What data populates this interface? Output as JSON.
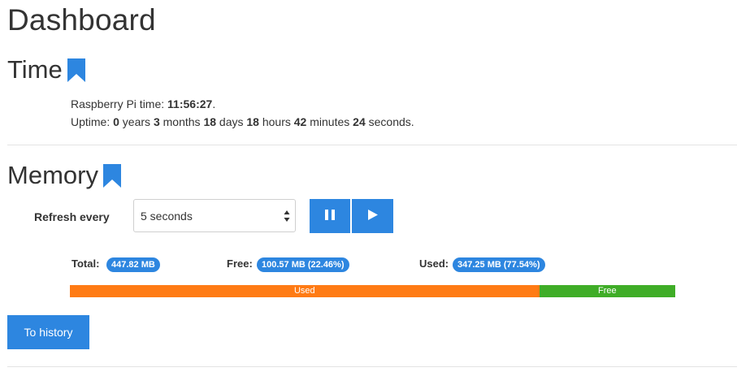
{
  "page": {
    "title": "Dashboard"
  },
  "time": {
    "title": "Time",
    "pi_time_label": "Raspberry Pi time: ",
    "pi_time_value": "11:56:27",
    "pi_time_suffix": ".",
    "uptime_label": "Uptime: ",
    "years": "0",
    "years_label": " years ",
    "months": "3",
    "months_label": " months ",
    "days": "18",
    "days_label": " days ",
    "hours": "18",
    "hours_label": " hours ",
    "minutes": "42",
    "minutes_label": " minutes ",
    "seconds": "24",
    "seconds_label": " seconds."
  },
  "memory": {
    "title": "Memory",
    "refresh_label": "Refresh every",
    "refresh_selected": "5 seconds",
    "total_label": "Total:",
    "total_value": "447.82 MB",
    "free_label": "Free:",
    "free_value": "100.57 MB (22.46%)",
    "used_label": "Used:",
    "used_value": "347.25 MB (77.54%)",
    "bar": {
      "used_label": "Used",
      "free_label": "Free",
      "used_percent": 77.54,
      "free_percent": 22.46,
      "used_color": "#ff7b14",
      "free_color": "#3fad27"
    },
    "icons": {
      "pause": "pause-icon",
      "play": "play-icon"
    }
  },
  "history_button": "To history",
  "accent_color": "#2d86e0"
}
